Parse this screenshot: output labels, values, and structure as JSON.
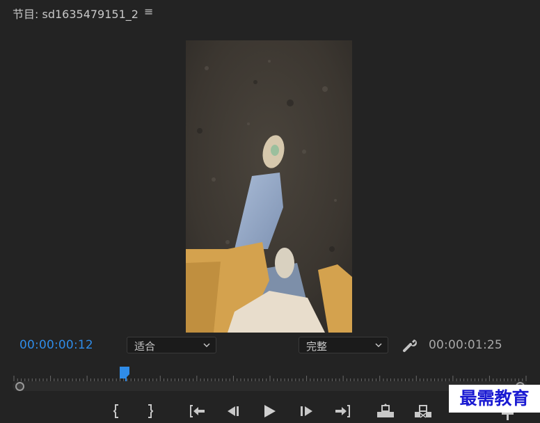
{
  "panel": {
    "title": "节目: sd1635479151_2",
    "menu_glyph": "≡"
  },
  "timecodes": {
    "current": "00:00:00:12",
    "duration": "00:00:01:25"
  },
  "zoom_dropdown": {
    "value": "适合",
    "icon": "chevron-down-icon"
  },
  "resolution_dropdown": {
    "value": "完整",
    "icon": "chevron-down-icon"
  },
  "playback": {
    "playhead_fraction": 0.22
  },
  "transport": [
    {
      "name": "mark-in-button",
      "icon": "mark-in-icon"
    },
    {
      "name": "mark-out-button",
      "icon": "mark-out-icon"
    },
    {
      "name": "go-to-in-button",
      "icon": "go-to-in-icon"
    },
    {
      "name": "step-back-button",
      "icon": "step-back-icon"
    },
    {
      "name": "play-button",
      "icon": "play-icon"
    },
    {
      "name": "step-forward-button",
      "icon": "step-forward-icon"
    },
    {
      "name": "go-to-out-button",
      "icon": "go-to-out-icon"
    },
    {
      "name": "lift-button",
      "icon": "lift-icon"
    },
    {
      "name": "extract-button",
      "icon": "extract-icon"
    },
    {
      "name": "add-button",
      "icon": "plus-icon"
    }
  ],
  "watermark": {
    "text": "最需教育"
  },
  "colors": {
    "background": "#232323",
    "timecode_accent": "#2f8ce8",
    "watermark_text": "#1a1ad2"
  }
}
